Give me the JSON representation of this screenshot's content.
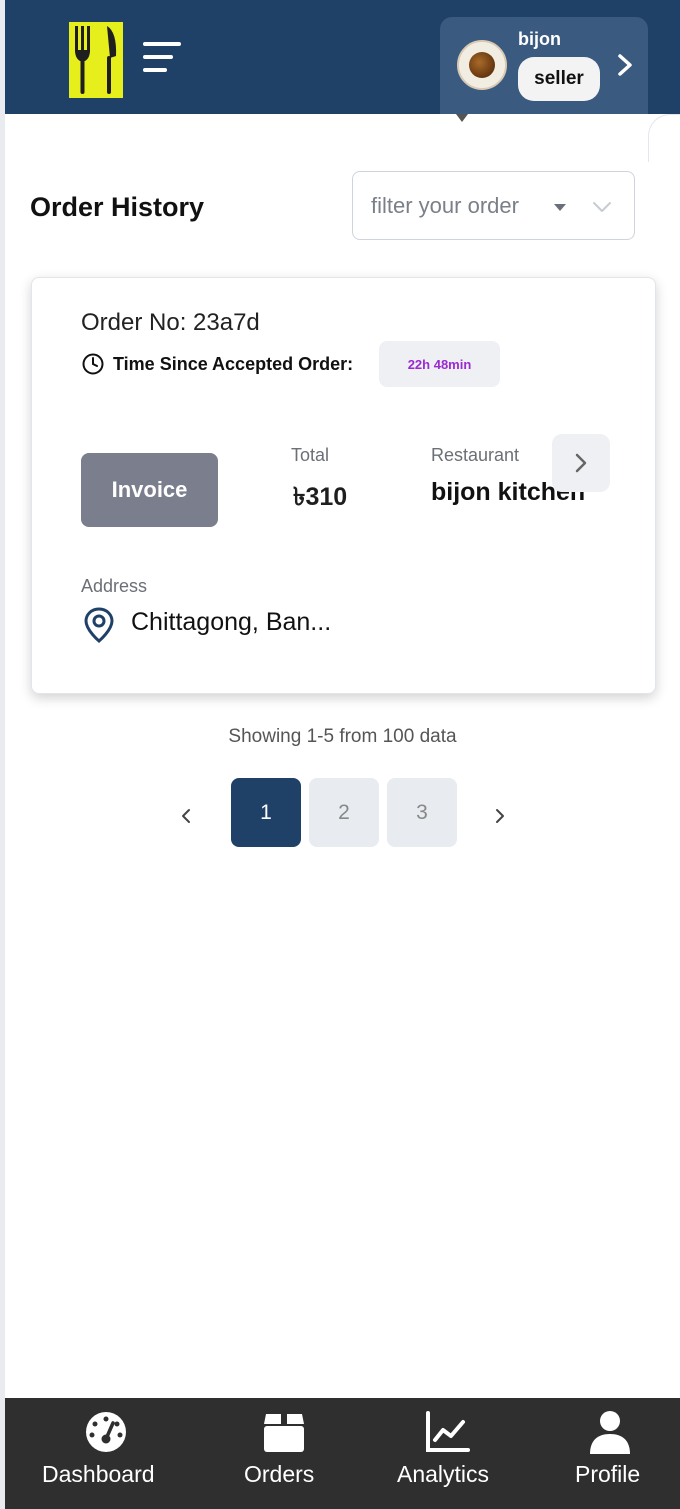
{
  "header": {
    "user_name": "bijon",
    "user_role": "seller"
  },
  "page": {
    "title": "Order History",
    "filter_placeholder": "filter your order"
  },
  "order": {
    "order_no": "Order No: 23a7d",
    "time_label": "Time Since Accepted Order:",
    "time_value": "22h 48min",
    "invoice_label": "Invoice",
    "total_label": "Total",
    "total_value": "৳310",
    "restaurant_label": "Restaurant",
    "restaurant_value": "bijon kitchen",
    "address_label": "Address",
    "address_value": "Chittagong, Ban..."
  },
  "pagination": {
    "summary": "Showing 1-5 from 100 data",
    "prev_symbol": "‹",
    "next_symbol": "›",
    "pages": [
      "1",
      "2",
      "3"
    ],
    "active_page": "1"
  },
  "bottom_nav": {
    "items": [
      {
        "label": "Dashboard",
        "icon": "speedometer-icon"
      },
      {
        "label": "Orders",
        "icon": "box-icon"
      },
      {
        "label": "Analytics",
        "icon": "line-chart-icon"
      },
      {
        "label": "Profile",
        "icon": "user-icon"
      }
    ]
  },
  "colors": {
    "header_bg": "#1f4168",
    "logo_bg": "#e6ee1c",
    "active_page": "#1f4168",
    "invoice_button": "#7b7f8d",
    "time_badge_text": "#9b2ad1",
    "bottom_nav_bg": "#2f2f2f"
  }
}
